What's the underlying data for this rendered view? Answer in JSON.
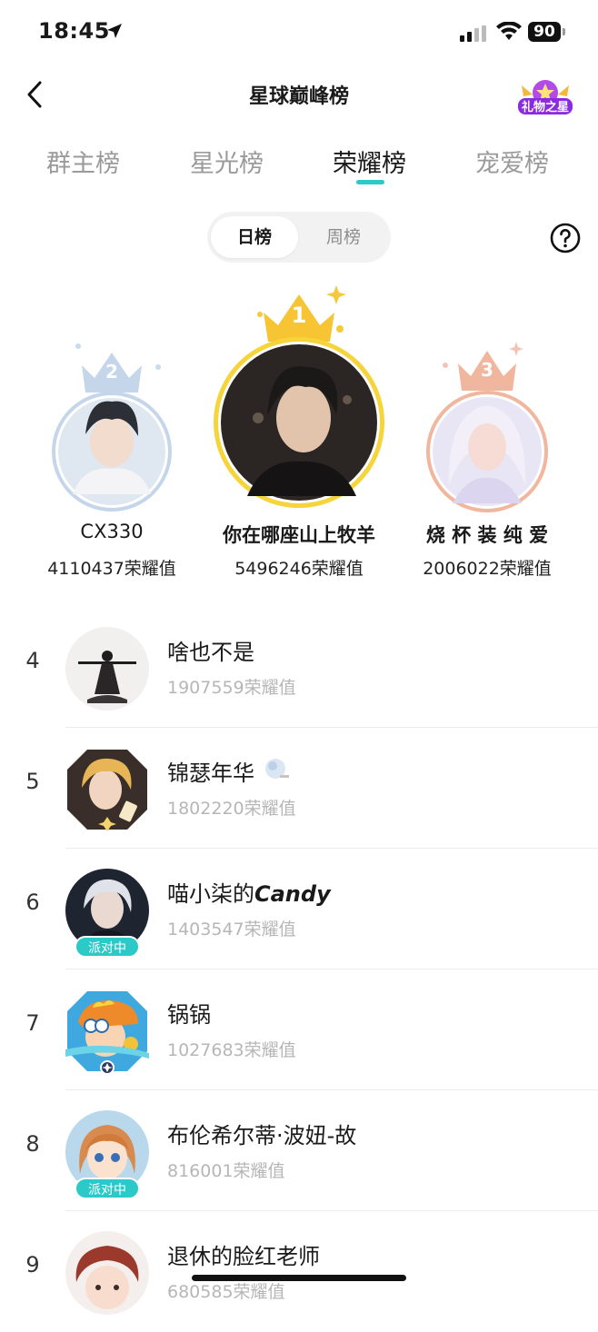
{
  "status_bar": {
    "time": "18:45",
    "battery": "90"
  },
  "header": {
    "title": "星球巅峰榜",
    "badge_label": "礼物之星"
  },
  "tabs": [
    {
      "label": "群主榜",
      "active": false
    },
    {
      "label": "星光榜",
      "active": false
    },
    {
      "label": "荣耀榜",
      "active": true
    },
    {
      "label": "宠爱榜",
      "active": false
    }
  ],
  "period_toggle": {
    "options": [
      "日榜",
      "周榜"
    ],
    "selected": "日榜"
  },
  "podium": [
    {
      "rank": "1",
      "name": "你在哪座山上牧羊",
      "score": "5496246荣耀值"
    },
    {
      "rank": "2",
      "name": "CX330",
      "score": "4110437荣耀值"
    },
    {
      "rank": "3",
      "name": "烧 杯 装 纯 爱",
      "score": "2006022荣耀值"
    }
  ],
  "list": [
    {
      "rank": "4",
      "name": "啥也不是",
      "score": "1907559荣耀值",
      "badge": ""
    },
    {
      "rank": "5",
      "name": "锦瑟年华",
      "score": "1802220荣耀值",
      "badge": ""
    },
    {
      "rank": "6",
      "name": "喵小柒的",
      "name_suffix": "Candy",
      "score": "1403547荣耀值",
      "badge": "派对中"
    },
    {
      "rank": "7",
      "name": "锅锅",
      "score": "1027683荣耀值",
      "badge": ""
    },
    {
      "rank": "8",
      "name": "布伦希尔蒂·波妞-故",
      "score": "816001荣耀值",
      "badge": "派对中"
    },
    {
      "rank": "9",
      "name": "退休的脸红老师",
      "score": "680585荣耀值",
      "badge": ""
    }
  ],
  "colors": {
    "accent": "#2cc9c9",
    "gold": "#f5c93a",
    "silver": "#c5d6ea",
    "bronze": "#f0b39a"
  }
}
